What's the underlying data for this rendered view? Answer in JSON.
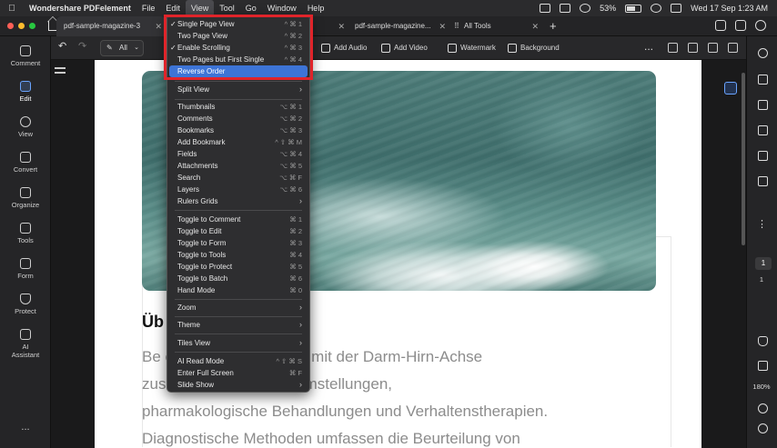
{
  "menubar": {
    "app_name": "Wondershare PDFelement",
    "items": [
      "File",
      "Edit",
      "View",
      "Tool",
      "Go",
      "Window",
      "Help"
    ],
    "active_item": "View",
    "battery": "53%",
    "datetime": "Wed 17 Sep  1:23 AM"
  },
  "tabs": [
    {
      "label": "pdf-sample-magazine-3"
    },
    {
      "label": "pdf-sample-magazine-..."
    },
    {
      "label": "pdf-sample-magazine..."
    },
    {
      "label": "All Tools"
    }
  ],
  "sidebar": {
    "items": [
      {
        "label": "Comment"
      },
      {
        "label": "Edit"
      },
      {
        "label": "View"
      },
      {
        "label": "Convert"
      },
      {
        "label": "Organize"
      },
      {
        "label": "Tools"
      },
      {
        "label": "Form"
      },
      {
        "label": "Protect"
      },
      {
        "label": "AI Assistant"
      },
      {
        "label": "..."
      }
    ],
    "active": "Edit"
  },
  "toolbar": {
    "filter_label": "All",
    "add_audio": "Add Audio",
    "add_video": "Add Video",
    "watermark": "Watermark",
    "background": "Background",
    "more": "..."
  },
  "document": {
    "heading": "Üb",
    "lines": [
      "Be                              ei Erkrankungen, die mit der Darm-Hirn-Achse",
      "zus                              assen Ernährungsumstellungen,",
      "pharmakologische Behandlungen und Verhaltenstherapien.",
      "Diagnostische Methoden umfassen die Beurteilung von"
    ]
  },
  "rightrail": {
    "page_current": "1",
    "page_total": "1",
    "zoom": "180%"
  },
  "view_menu": {
    "items": [
      {
        "label": "Single Page View",
        "shortcut": "^ ⌘ 1",
        "checked": true
      },
      {
        "label": "Two Page View",
        "shortcut": "^ ⌘ 2",
        "checked": false
      },
      {
        "label": "Enable Scrolling",
        "shortcut": "^ ⌘ 3",
        "checked": true
      },
      {
        "label": "Two Pages but First Single",
        "shortcut": "^ ⌘ 4",
        "checked": false
      },
      {
        "label": "Reverse Order",
        "shortcut": "",
        "highlighted": true
      },
      {
        "label": "Split View",
        "submenu": true
      },
      {
        "label": "Thumbnails",
        "shortcut": "⌥ ⌘ 1"
      },
      {
        "label": "Comments",
        "shortcut": "⌥ ⌘ 2"
      },
      {
        "label": "Bookmarks",
        "shortcut": "⌥ ⌘ 3"
      },
      {
        "label": "Add Bookmark",
        "shortcut": "^ ⇧ ⌘ M"
      },
      {
        "label": "Fields",
        "shortcut": "⌥ ⌘ 4"
      },
      {
        "label": "Attachments",
        "shortcut": "⌥ ⌘ 5"
      },
      {
        "label": "Search",
        "shortcut": "⌥ ⌘ F"
      },
      {
        "label": "Layers",
        "shortcut": "⌥ ⌘ 6"
      },
      {
        "label": "Rulers Grids",
        "submenu": true
      },
      {
        "label": "Toggle to Comment",
        "shortcut": "⌘ 1"
      },
      {
        "label": "Toggle to Edit",
        "shortcut": "⌘ 2"
      },
      {
        "label": "Toggle to Form",
        "shortcut": "⌘ 3"
      },
      {
        "label": "Toggle to Tools",
        "shortcut": "⌘ 4"
      },
      {
        "label": "Toggle to Protect",
        "shortcut": "⌘ 5"
      },
      {
        "label": "Toggle to Batch",
        "shortcut": "⌘ 6"
      },
      {
        "label": "Hand Mode",
        "shortcut": "⌘ 0"
      },
      {
        "label": "Zoom",
        "submenu": true
      },
      {
        "label": "Theme",
        "submenu": true
      },
      {
        "label": "Tiles View",
        "submenu": true
      },
      {
        "label": "AI Read Mode",
        "shortcut": "^ ⇧ ⌘ S"
      },
      {
        "label": "Enter Full Screen",
        "shortcut": "⌘ F"
      },
      {
        "label": "Slide Show",
        "submenu": true
      }
    ]
  },
  "colors": {
    "highlight": "#3d74d6",
    "annotation_box": "#e0242a"
  }
}
